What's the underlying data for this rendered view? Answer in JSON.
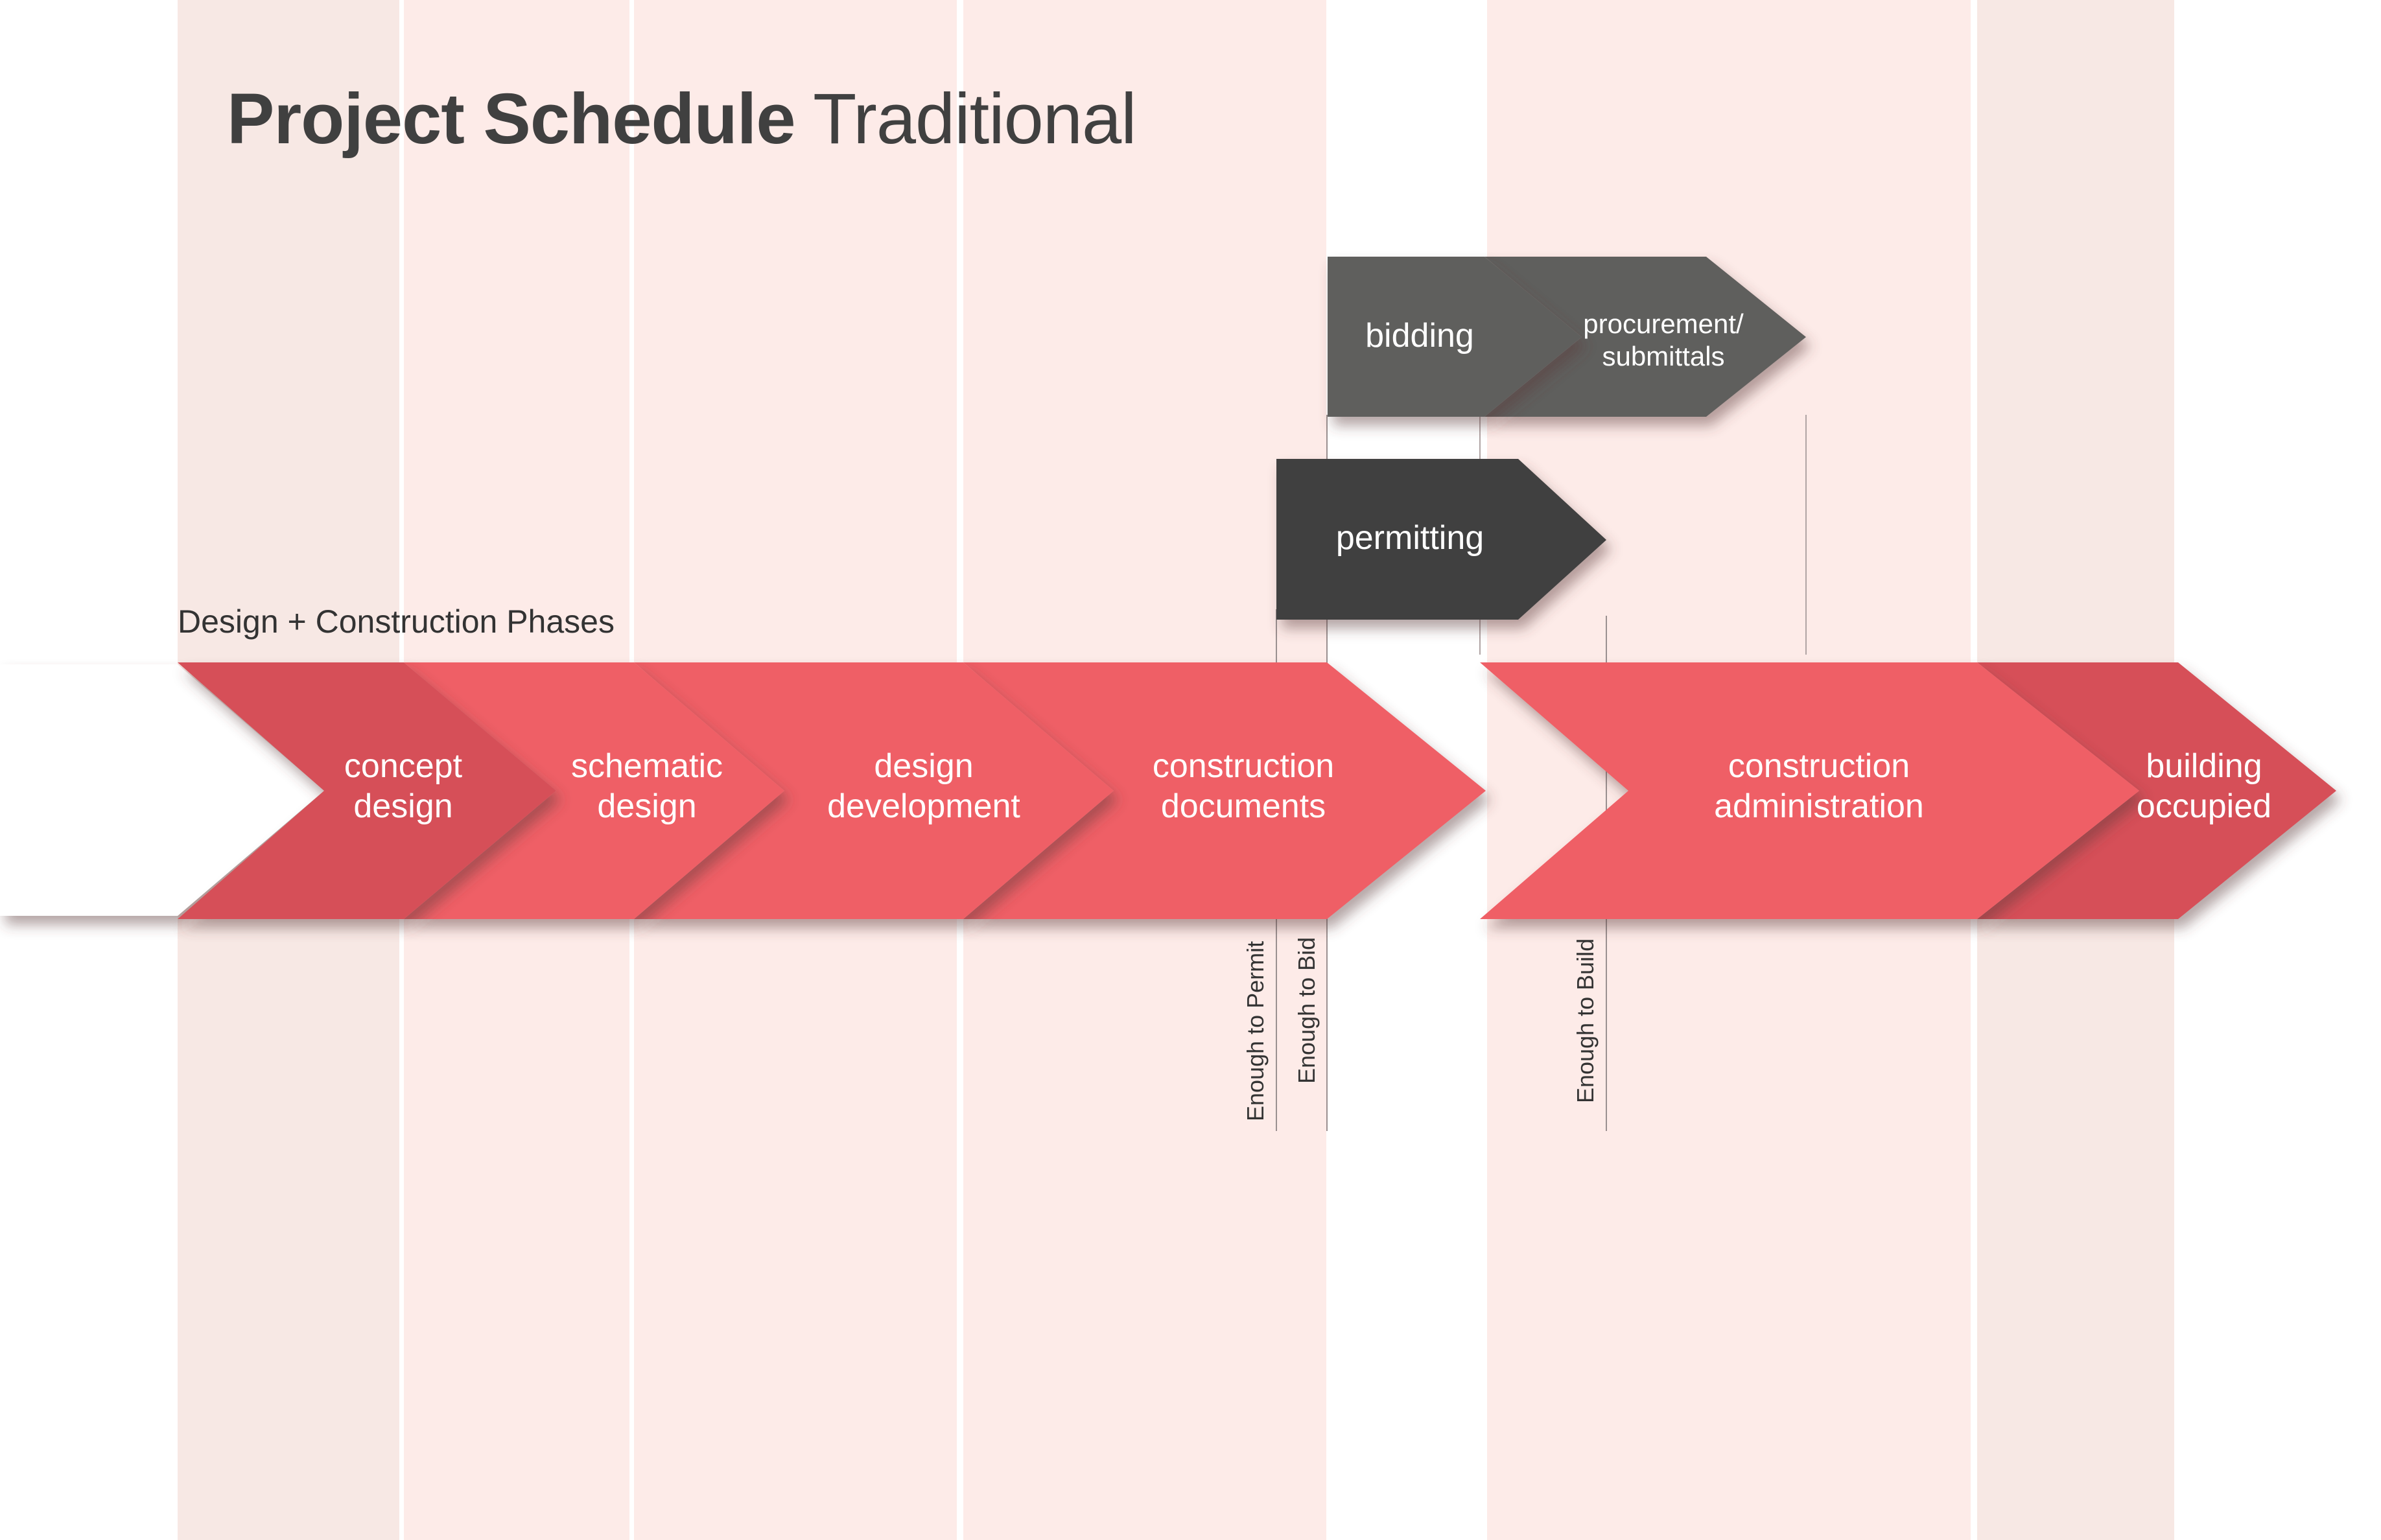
{
  "title": {
    "bold": "Project Schedule",
    "light": "Traditional"
  },
  "subtitle": "Design + Construction Phases",
  "colors": {
    "phase_light": "#ef5f66",
    "phase_dark": "#d64f58",
    "bidding_gray": "#5f5f5d",
    "permitting_gray": "#3f4140",
    "band_dark": "#f7e8e4",
    "band_light": "#fdebe8",
    "text_dark": "#404040"
  },
  "phases": [
    {
      "id": "concept-design",
      "line1": "concept",
      "line2": "design"
    },
    {
      "id": "schematic-design",
      "line1": "schematic",
      "line2": "design"
    },
    {
      "id": "design-development",
      "line1": "design",
      "line2": "development"
    },
    {
      "id": "construction-documents",
      "line1": "construction",
      "line2": "documents"
    },
    {
      "id": "construction-administration",
      "line1": "construction",
      "line2": "administration"
    },
    {
      "id": "building-occupied",
      "line1": "building",
      "line2": "occupied"
    }
  ],
  "parallel_tasks": [
    {
      "id": "bidding",
      "line1": "bidding"
    },
    {
      "id": "procurement-submittals",
      "line1": "procurement/",
      "line2": "submittals"
    },
    {
      "id": "permitting",
      "line1": "permitting"
    }
  ],
  "milestones": [
    {
      "id": "enough-to-permit",
      "label": "Enough to Permit"
    },
    {
      "id": "enough-to-bid",
      "label": "Enough to Bid"
    },
    {
      "id": "enough-to-build",
      "label": "Enough to Build"
    }
  ]
}
